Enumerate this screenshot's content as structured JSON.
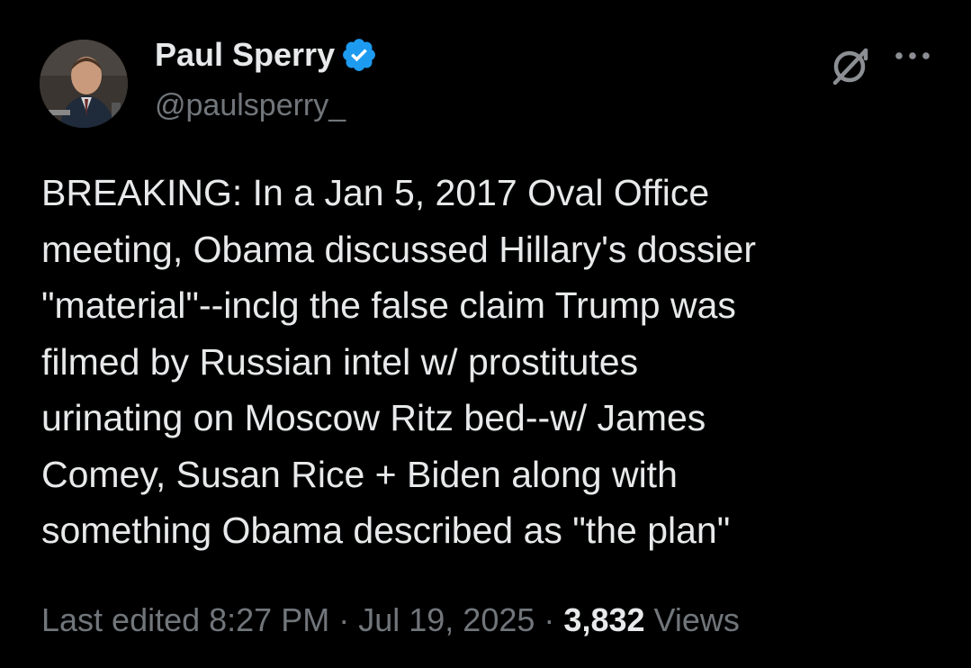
{
  "author": {
    "name": "Paul Sperry",
    "handle": "@paulsperry_",
    "verified": true,
    "verified_color": "#1d9bf0"
  },
  "tweet": {
    "text": "BREAKING: In a Jan 5, 2017 Oval Office\nmeeting, Obama discussed Hillary's dossier\n\"material\"--inclg the false claim Trump was\nfilmed by Russian intel w/ prostitutes\nurinating on Moscow Ritz bed--w/ James\nComey, Susan Rice + Biden along with\nsomething Obama described as \"the plan\""
  },
  "meta": {
    "edited_label": "Last edited 8:27 PM",
    "separator": "·",
    "date": "Jul 19, 2025",
    "views_count": "3,832",
    "views_label": "Views"
  },
  "icons": {
    "grok": "grok-icon",
    "more": "more-icon",
    "verified": "verified-badge-icon"
  }
}
